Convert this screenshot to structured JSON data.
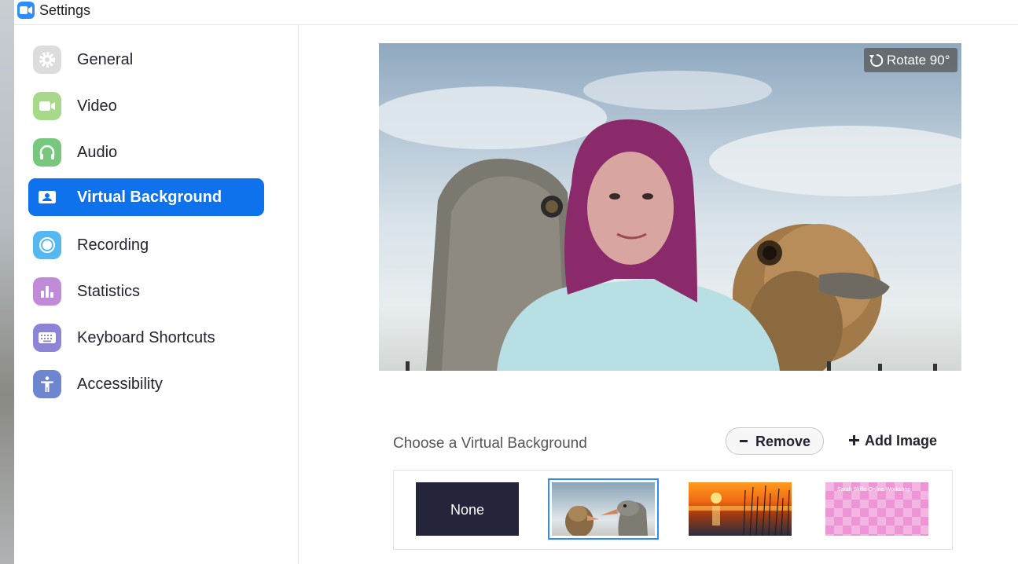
{
  "window": {
    "title": "Settings"
  },
  "sidebar": {
    "items": [
      {
        "label": "General",
        "icon": "gear-icon",
        "color": "#e6e6e6",
        "active": false
      },
      {
        "label": "Video",
        "icon": "video-camera-icon",
        "color": "#a8d98a",
        "active": false
      },
      {
        "label": "Audio",
        "icon": "headphones-icon",
        "color": "#78c77e",
        "active": false
      },
      {
        "label": "Virtual Background",
        "icon": "person-card-icon",
        "color": "#0e72ed",
        "active": true
      },
      {
        "label": "Recording",
        "icon": "record-icon",
        "color": "#55b8f0",
        "active": false
      },
      {
        "label": "Statistics",
        "icon": "bar-chart-icon",
        "color": "#c28bd9",
        "active": false
      },
      {
        "label": "Keyboard Shortcuts",
        "icon": "keyboard-icon",
        "color": "#8c84d6",
        "active": false
      },
      {
        "label": "Accessibility",
        "icon": "accessibility-icon",
        "color": "#6e86cf",
        "active": false
      }
    ]
  },
  "preview": {
    "rotate_label": "Rotate 90°"
  },
  "background_chooser": {
    "title": "Choose a Virtual Background",
    "remove_label": "Remove",
    "add_label": "Add Image",
    "thumbnails": [
      {
        "label": "None",
        "kind": "none",
        "selected": false
      },
      {
        "kind": "ostrich",
        "selected": true
      },
      {
        "kind": "sunset",
        "selected": false
      },
      {
        "kind": "pink-pattern",
        "selected": false,
        "text": "Sarah Sliffle Online Workshop"
      }
    ]
  },
  "colors": {
    "accent": "#0e72ed",
    "selection": "#2d8cff",
    "text": "#232333"
  }
}
